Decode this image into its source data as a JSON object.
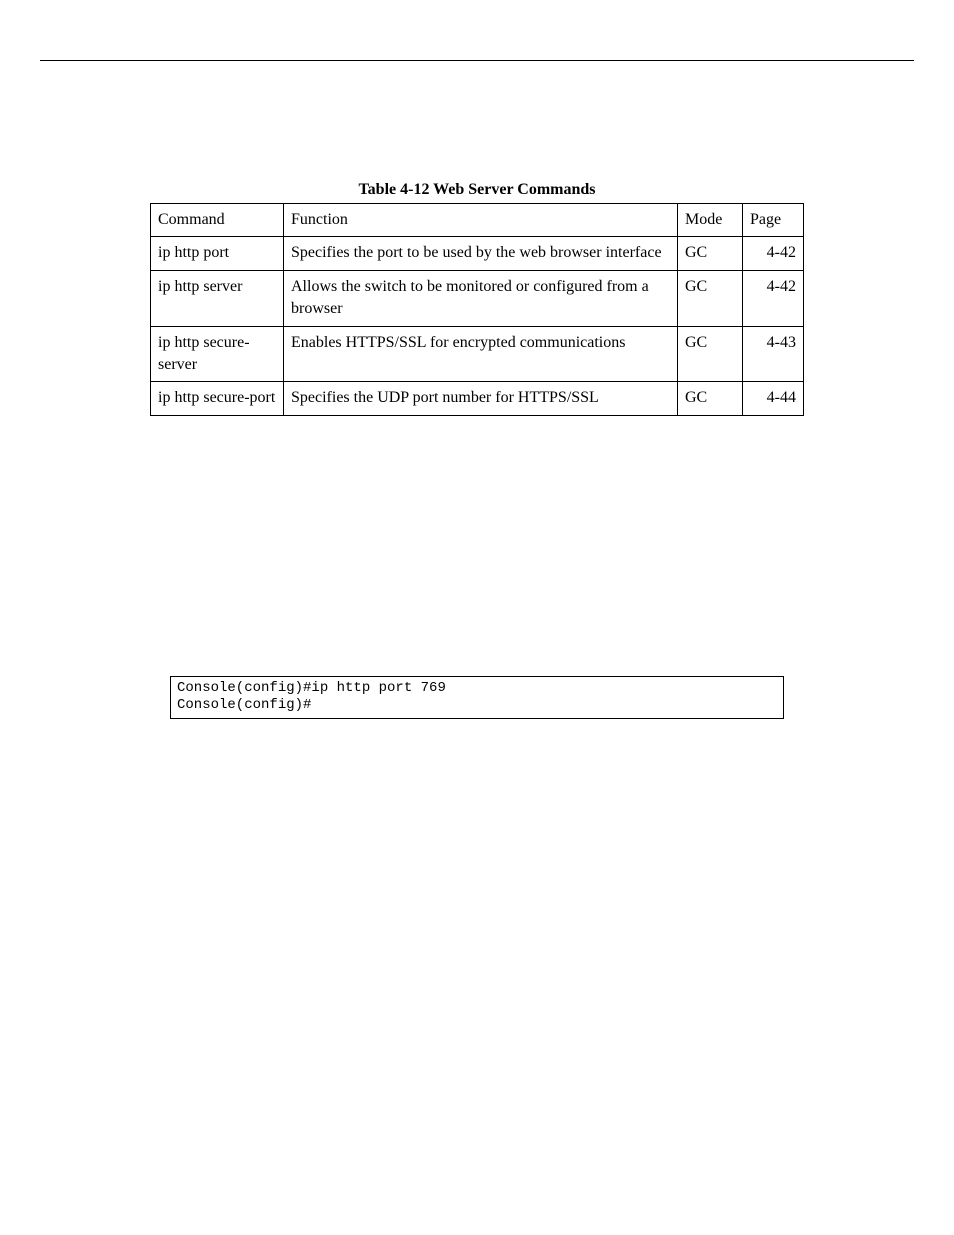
{
  "table": {
    "title": "Table 4-12  Web Server Commands",
    "headers": {
      "command": "Command",
      "function": "Function",
      "mode": "Mode",
      "page": "Page"
    },
    "rows": [
      {
        "command": "ip http port",
        "function": "Specifies the port to be used by the web browser interface",
        "mode": "GC",
        "page": "4-42"
      },
      {
        "command": "ip http server",
        "function": "Allows the switch to be monitored or configured from a browser",
        "mode": "GC",
        "page": "4-42"
      },
      {
        "command": "ip http secure-server",
        "function": "Enables HTTPS/SSL for encrypted communications",
        "mode": "GC",
        "page": "4-43"
      },
      {
        "command": "ip http secure-port",
        "function": "Specifies the UDP port number for HTTPS/SSL",
        "mode": "GC",
        "page": "4-44"
      }
    ]
  },
  "console": {
    "text": "Console(config)#ip http port 769\nConsole(config)#"
  }
}
